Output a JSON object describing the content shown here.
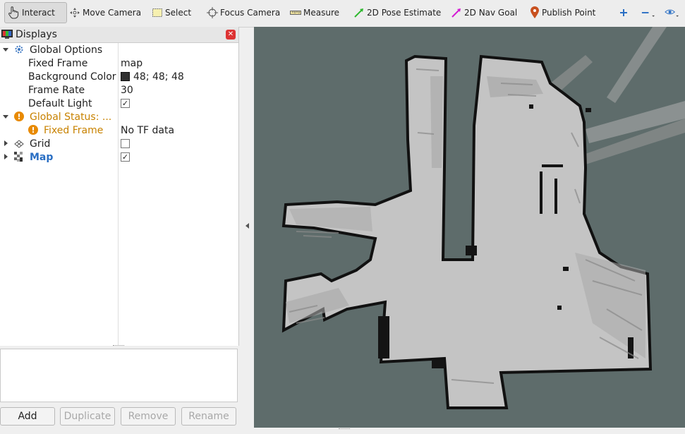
{
  "toolbar": {
    "interact": "Interact",
    "move_camera": "Move Camera",
    "select": "Select",
    "focus_camera": "Focus Camera",
    "measure": "Measure",
    "pose_estimate": "2D Pose Estimate",
    "nav_goal": "2D Nav Goal",
    "publish_point": "Publish Point"
  },
  "displays": {
    "title": "Displays",
    "global_options": {
      "label": "Global Options",
      "fixed_frame_label": "Fixed Frame",
      "fixed_frame_value": "map",
      "background_color_label": "Background Color",
      "background_color_value": "48; 48; 48",
      "background_color_hex": "#303030",
      "frame_rate_label": "Frame Rate",
      "frame_rate_value": "30",
      "default_light_label": "Default Light",
      "default_light_checked": true
    },
    "global_status": {
      "label": "Global Status: ...",
      "fixed_frame_label": "Fixed Frame",
      "fixed_frame_value": "No TF data"
    },
    "grid": {
      "label": "Grid",
      "checked": false
    },
    "map": {
      "label": "Map",
      "checked": true
    }
  },
  "buttons": {
    "add": "Add",
    "duplicate": "Duplicate",
    "remove": "Remove",
    "rename": "Rename"
  },
  "colors": {
    "viewport_background": "#5e6c6b",
    "map_free": "#c4c4c4",
    "map_occupied": "#111111",
    "warning": "#e88a00",
    "link": "#2a6fc4"
  }
}
